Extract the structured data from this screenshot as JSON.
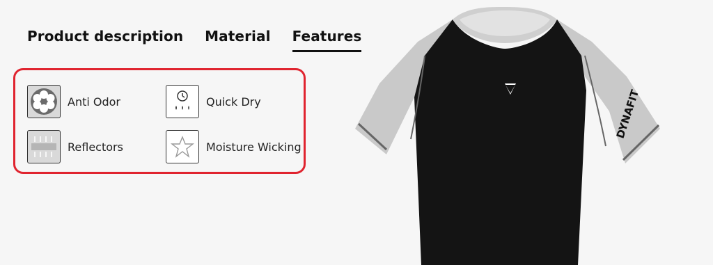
{
  "tabs": [
    {
      "label": "Product description",
      "active": false
    },
    {
      "label": "Material",
      "active": false
    },
    {
      "label": "Features",
      "active": true
    }
  ],
  "features": [
    {
      "label": "Anti Odor",
      "icon": "anti-odor-icon"
    },
    {
      "label": "Quick Dry",
      "icon": "quick-dry-icon"
    },
    {
      "label": "Reflectors",
      "icon": "reflectors-icon"
    },
    {
      "label": "Moisture Wicking",
      "icon": "moisture-wicking-icon"
    }
  ],
  "product": {
    "sleeve_text": "DYNAFIT",
    "colors": {
      "body": "#141414",
      "sleeve": "#c9c9c9",
      "highlight": "#e0242f"
    }
  }
}
